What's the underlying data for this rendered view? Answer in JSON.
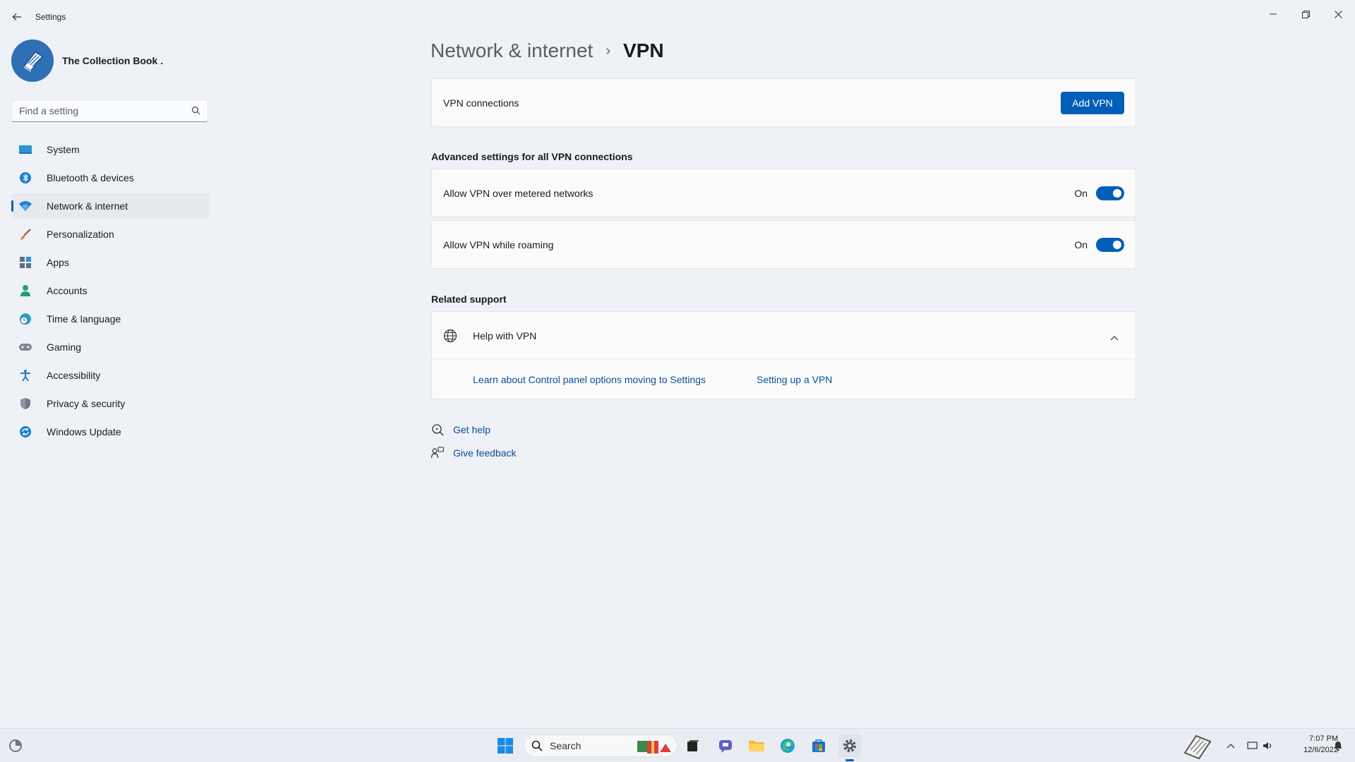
{
  "window": {
    "title": "Settings",
    "minimize_icon": "minimize-icon",
    "restore_icon": "restore-icon",
    "close_icon": "close-icon"
  },
  "profile": {
    "name": "The Collection Book ."
  },
  "search": {
    "placeholder": "Find a setting"
  },
  "sidebar": {
    "items": [
      {
        "label": "System",
        "icon": "monitor-icon"
      },
      {
        "label": "Bluetooth & devices",
        "icon": "bluetooth-icon"
      },
      {
        "label": "Network & internet",
        "icon": "wifi-icon",
        "active": true
      },
      {
        "label": "Personalization",
        "icon": "brush-icon"
      },
      {
        "label": "Apps",
        "icon": "apps-icon"
      },
      {
        "label": "Accounts",
        "icon": "person-icon"
      },
      {
        "label": "Time & language",
        "icon": "globe-clock-icon"
      },
      {
        "label": "Gaming",
        "icon": "gamepad-icon"
      },
      {
        "label": "Accessibility",
        "icon": "accessibility-icon"
      },
      {
        "label": "Privacy & security",
        "icon": "shield-icon"
      },
      {
        "label": "Windows Update",
        "icon": "update-icon"
      }
    ]
  },
  "breadcrumb": {
    "parent": "Network & internet",
    "separator": "›",
    "current": "VPN"
  },
  "vpn": {
    "connections_label": "VPN connections",
    "add_button": "Add VPN"
  },
  "advanced": {
    "title": "Advanced settings for all VPN connections",
    "metered": {
      "label": "Allow VPN over metered networks",
      "state": "On"
    },
    "roaming": {
      "label": "Allow VPN while roaming",
      "state": "On"
    }
  },
  "support": {
    "title": "Related support",
    "help_title": "Help with VPN",
    "links": [
      "Learn about Control panel options moving to Settings",
      "Setting up a VPN"
    ]
  },
  "footer": {
    "get_help": "Get help",
    "give_feedback": "Give feedback"
  },
  "taskbar": {
    "search_label": "Search",
    "time": "7:07 PM",
    "date": "12/6/2022"
  },
  "colors": {
    "accent": "#005fb8",
    "background": "#eef1f6",
    "card": "#fbfbfb",
    "link": "#0a4f9c"
  }
}
